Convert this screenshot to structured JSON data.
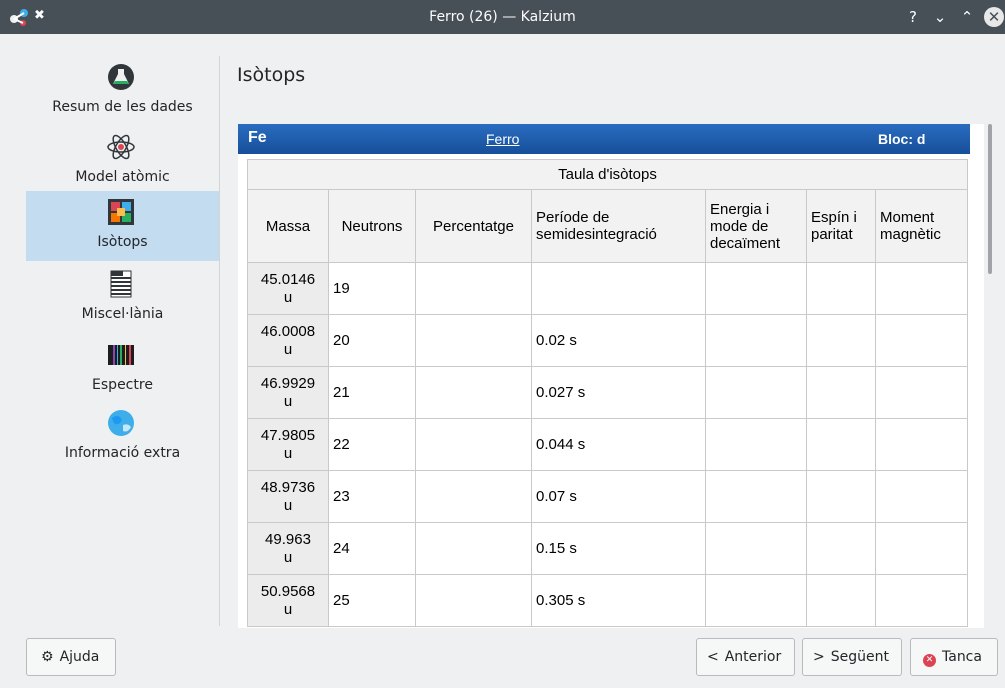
{
  "window": {
    "title": "Ferro (26) — Kalzium",
    "help_glyph": "?",
    "min_glyph": "⌄",
    "max_glyph": "⌃",
    "close_glyph": "✕",
    "pin_glyph": "✖"
  },
  "sidebar": {
    "items": [
      {
        "label": "Resum de les dades",
        "icon": "flask-icon"
      },
      {
        "label": "Model atòmic",
        "icon": "atom-icon"
      },
      {
        "label": "Isòtops",
        "icon": "isotopes-grid-icon",
        "active": true
      },
      {
        "label": "Miscel·lània",
        "icon": "misc-stripes-icon"
      },
      {
        "label": "Espectre",
        "icon": "spectrum-icon"
      },
      {
        "label": "Informació extra",
        "icon": "globe-icon"
      }
    ]
  },
  "main": {
    "title": "Isòtops",
    "element": {
      "symbol": "Fe",
      "name": "Ferro",
      "block": "Bloc: d"
    },
    "table": {
      "caption": "Taula d'isòtops",
      "headers": [
        "Massa",
        "Neutrons",
        "Percentatge",
        "Període de semidesintegració",
        "Energia i mode de decaïment",
        "Espín i paritat",
        "Moment magnètic"
      ],
      "rows": [
        {
          "massa": "45.0146",
          "unit": "u",
          "neutrons": "19",
          "perc": "",
          "period": "",
          "energy": "",
          "spin": "",
          "moment": ""
        },
        {
          "massa": "46.0008",
          "unit": "u",
          "neutrons": "20",
          "perc": "",
          "period": "0.02 s",
          "energy": "",
          "spin": "",
          "moment": ""
        },
        {
          "massa": "46.9929",
          "unit": "u",
          "neutrons": "21",
          "perc": "",
          "period": "0.027 s",
          "energy": "",
          "spin": "",
          "moment": ""
        },
        {
          "massa": "47.9805",
          "unit": "u",
          "neutrons": "22",
          "perc": "",
          "period": "0.044 s",
          "energy": "",
          "spin": "",
          "moment": ""
        },
        {
          "massa": "48.9736",
          "unit": "u",
          "neutrons": "23",
          "perc": "",
          "period": "0.07 s",
          "energy": "",
          "spin": "",
          "moment": ""
        },
        {
          "massa": "49.963",
          "unit": "u",
          "neutrons": "24",
          "perc": "",
          "period": "0.15 s",
          "energy": "",
          "spin": "",
          "moment": ""
        },
        {
          "massa": "50.9568",
          "unit": "u",
          "neutrons": "25",
          "perc": "",
          "period": "0.305 s",
          "energy": "",
          "spin": "",
          "moment": ""
        }
      ]
    }
  },
  "buttons": {
    "help": "Ajuda",
    "previous": "Anterior",
    "next": "Següent",
    "close": "Tanca",
    "previous_glyph": "<",
    "next_glyph": ">",
    "help_glyph": "⚙",
    "close_glyph": "✕"
  },
  "colors": {
    "titlebar": "#475057",
    "header_blue": "#1a5fb4",
    "active_item": "#c4dcf0",
    "close_red": "#da4453"
  }
}
